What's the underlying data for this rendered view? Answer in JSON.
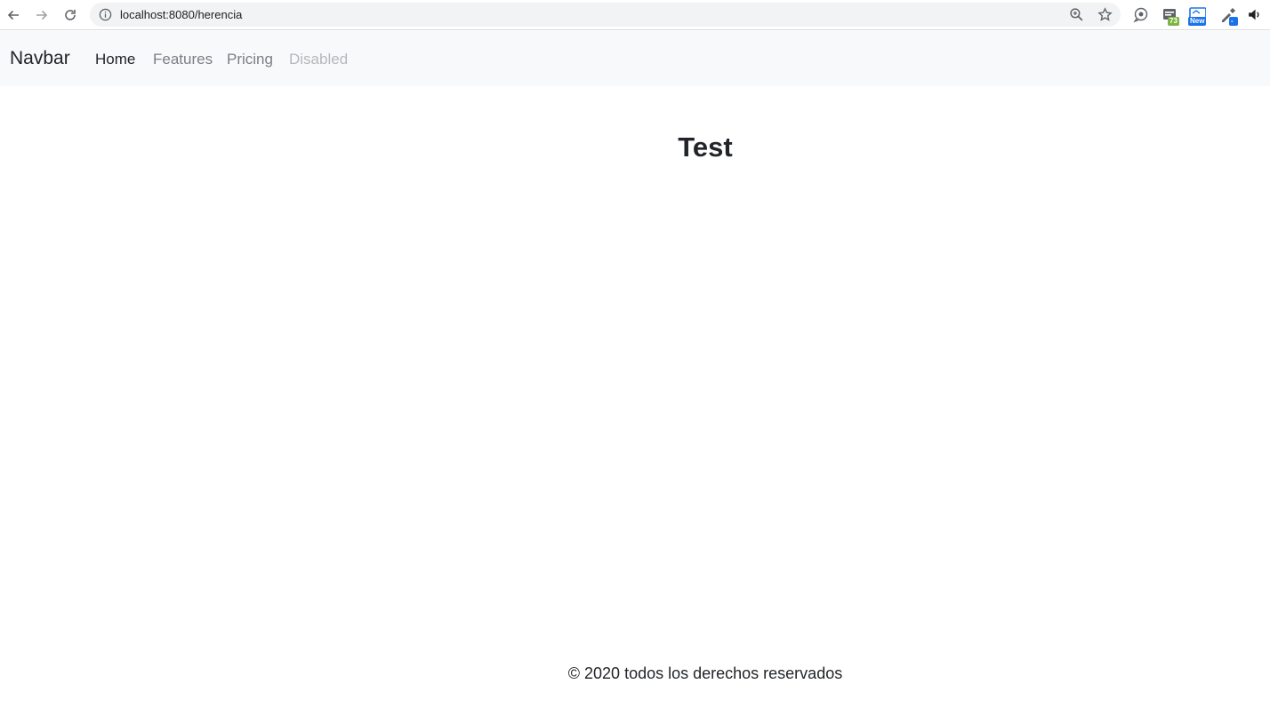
{
  "browser": {
    "url": "localhost:8080/herencia",
    "extensions": [
      {
        "name": "extension-1-icon",
        "badge": "73",
        "badge_color": "#7cb342"
      },
      {
        "name": "extension-2-icon",
        "badge": "New",
        "badge_color": "#1a73e8"
      },
      {
        "name": "extension-3-icon",
        "badge": "-",
        "badge_color": "#1a73e8"
      }
    ]
  },
  "navbar": {
    "brand": "Navbar",
    "links": [
      {
        "label": "Home",
        "state": "active"
      },
      {
        "label": "Features",
        "state": "normal"
      },
      {
        "label": "Pricing",
        "state": "normal"
      },
      {
        "label": "Disabled",
        "state": "disabled"
      }
    ]
  },
  "main": {
    "title": "Test"
  },
  "footer": {
    "text": "© 2020 todos los derechos reservados"
  },
  "colors": {
    "navbar_bg": "#f8f9fa",
    "text": "#212529",
    "link_muted": "#7a7f85",
    "link_disabled": "#b5b8bb"
  }
}
